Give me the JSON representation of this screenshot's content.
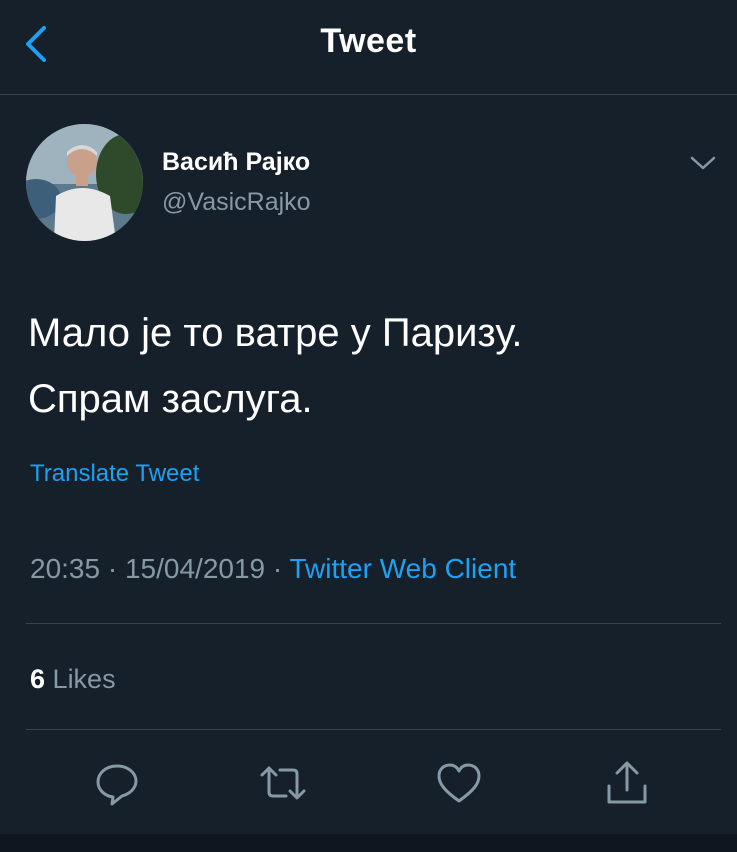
{
  "header": {
    "title": "Tweet",
    "back_icon": "chevron-left-icon"
  },
  "author": {
    "name": "Васић Рајко",
    "handle": "@VasicRajko"
  },
  "tweet": {
    "lines": [
      "Мало је то ватре у Паризу.",
      "Спрам заслуга."
    ],
    "translate_label": "Translate Tweet",
    "time": "20:35",
    "date": "15/04/2019",
    "separator": "·",
    "client": "Twitter Web Client"
  },
  "stats": {
    "likes_count": "6",
    "likes_label": "Likes"
  },
  "actions": [
    "reply-icon",
    "retweet-icon",
    "like-icon",
    "share-icon"
  ],
  "colors": {
    "background": "#15202b",
    "accent": "#1da1f2",
    "muted": "#8899a6",
    "divider": "#38444d"
  }
}
